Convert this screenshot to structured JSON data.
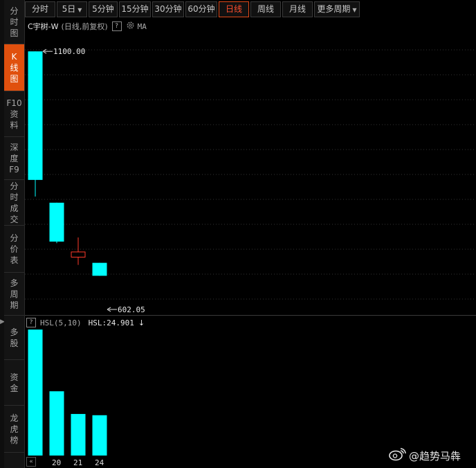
{
  "sidebar": {
    "items": [
      {
        "label": "分\n时\n图",
        "active": false
      },
      {
        "label": "K\n线\n图",
        "active": true
      },
      {
        "label": "F10\n资\n料",
        "active": false
      },
      {
        "label": "深\n度\nF9",
        "active": false
      },
      {
        "label": "分\n时\n成\n交",
        "active": false
      },
      {
        "label": "分\n价\n表",
        "active": false
      },
      {
        "label": "多\n周\n期",
        "active": false
      },
      {
        "label": "多\n股",
        "active": false
      },
      {
        "label": "资\n金",
        "active": false
      },
      {
        "label": "龙\n虎\n榜",
        "active": false
      }
    ],
    "collapse_icon": "▶"
  },
  "toolbar": {
    "tabs": [
      {
        "label": "分时",
        "dropdown": false,
        "active": false
      },
      {
        "label": "5日",
        "dropdown": true,
        "active": false
      },
      {
        "label": "5分钟",
        "dropdown": false,
        "active": false
      },
      {
        "label": "15分钟",
        "dropdown": false,
        "active": false
      },
      {
        "label": "30分钟",
        "dropdown": false,
        "active": false
      },
      {
        "label": "60分钟",
        "dropdown": false,
        "active": false
      },
      {
        "label": "日线",
        "dropdown": false,
        "active": true
      },
      {
        "label": "周线",
        "dropdown": false,
        "active": false
      },
      {
        "label": "月线",
        "dropdown": false,
        "active": false
      },
      {
        "label": "更多周期",
        "dropdown": true,
        "active": false
      }
    ]
  },
  "chart_header": {
    "name": "C宇树-W",
    "mode": "(日线,前复权)",
    "help": "?",
    "ma": "MA"
  },
  "volume_header": {
    "help": "?",
    "indicator": "HSL(5,10)",
    "value": "HSL:24.901",
    "trend_icon": "↓"
  },
  "chart_data": [
    {
      "type": "candlestick",
      "candles": [
        {
          "open": 1100.0,
          "close": 852.0,
          "high": 1100.0,
          "low": 820.0,
          "direction": "down"
        },
        {
          "open": 808.0,
          "close": 733.0,
          "high": 808.0,
          "low": 730.0,
          "direction": "down"
        },
        {
          "open": 703.0,
          "close": 713.0,
          "high": 741.0,
          "low": 688.0,
          "direction": "up"
        },
        {
          "open": 692.0,
          "close": 667.0,
          "high": 692.0,
          "low": 667.0,
          "direction": "down"
        }
      ],
      "annotations": [
        {
          "label": "1100.00",
          "value": 1100.0,
          "candle": 0
        },
        {
          "label": "602.05",
          "value": 602.05,
          "candle": 3
        }
      ],
      "grid": true,
      "colors": {
        "down": "#00ffff",
        "up": "#ff3a2a"
      }
    },
    {
      "type": "bar",
      "title": "HSL(5,10)",
      "values": [
        100,
        51,
        33,
        32
      ],
      "categories": [
        "",
        "20",
        "21",
        "24"
      ],
      "colors": {
        "bar": "#00ffff"
      }
    }
  ],
  "watermark": {
    "icon": "weibo-icon",
    "text": "@趋势马犇"
  }
}
